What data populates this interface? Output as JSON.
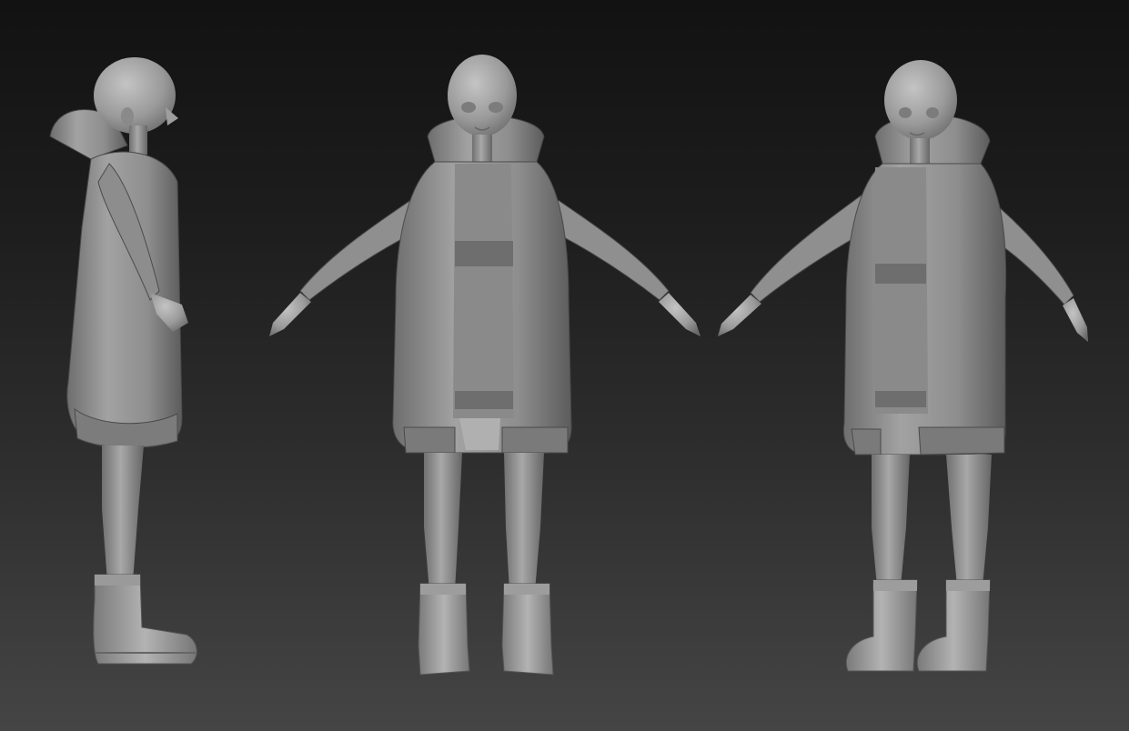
{
  "scene": {
    "background_top": "#121212",
    "background_bottom": "#454545",
    "material_light": "#a9a9a9",
    "material_mid": "#8c8c8c",
    "material_dark": "#5e5e5e",
    "views": [
      {
        "id": "side",
        "pose": "side-profile"
      },
      {
        "id": "front",
        "pose": "front-a-pose"
      },
      {
        "id": "three-quarter",
        "pose": "three-quarter-a-pose"
      }
    ]
  }
}
